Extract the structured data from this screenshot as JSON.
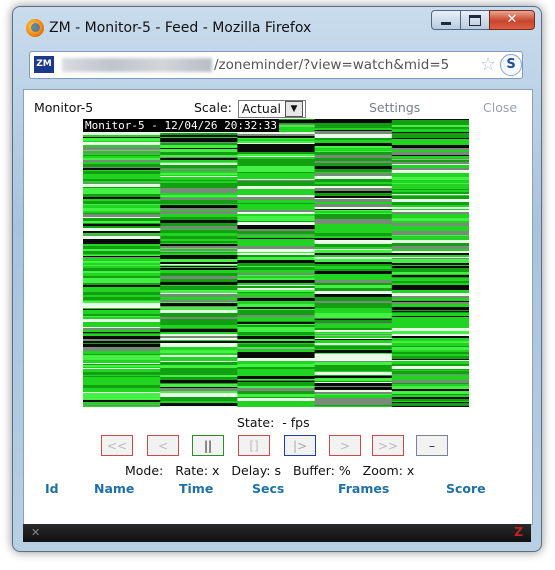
{
  "window": {
    "title": "ZM - Monitor-5 - Feed - Mozilla Firefox",
    "url_visible": "/zoneminder/?view=watch&mid=5",
    "site_icon": "ZM",
    "addon_icon": "S",
    "icons": {
      "browser": "firefox-icon",
      "bookmark": "star-icon"
    }
  },
  "page": {
    "monitor_name": "Monitor-5",
    "scale_label": "Scale:",
    "scale_value": "Actual",
    "settings_label": "Settings",
    "close_label": "Close",
    "feed_overlay": "Monitor-5 - 12/04/26 20:32:33",
    "state_text": "State:  - fps",
    "controls": [
      {
        "id": "fast-rewind",
        "label": "<<",
        "color": "#cc4a4a"
      },
      {
        "id": "step-back",
        "label": "<",
        "color": "#cc4a4a"
      },
      {
        "id": "pause",
        "label": "||",
        "color": "#2e8b2e"
      },
      {
        "id": "stop",
        "label": "[]",
        "color": "#cc4a4a"
      },
      {
        "id": "play",
        "label": "|>",
        "color": "#1f3fa5"
      },
      {
        "id": "step-forward",
        "label": ">",
        "color": "#cc4a4a"
      },
      {
        "id": "fast-forward",
        "label": ">>",
        "color": "#cc4a4a"
      },
      {
        "id": "zoom-out",
        "label": "–",
        "color": "#7a7f9a"
      }
    ],
    "stats": {
      "mode": "Mode:",
      "rate": "Rate: x",
      "delay": "Delay: s",
      "buffer": "Buffer: %",
      "zoom": "Zoom: x"
    },
    "events_headers": [
      "Id",
      "Name",
      "Time",
      "Secs",
      "Frames",
      "Score"
    ]
  },
  "statusbar": {
    "left_icon": "close-icon",
    "right_icon": "Z"
  }
}
